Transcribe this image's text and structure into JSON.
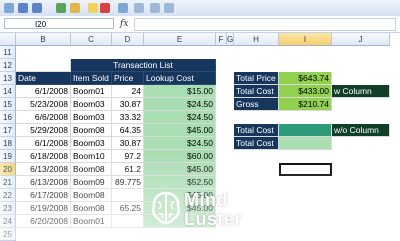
{
  "formula_bar": {
    "name_box": "I20",
    "fx_label": "fx",
    "formula": ""
  },
  "columns": [
    "B",
    "C",
    "D",
    "E",
    "F",
    "G",
    "H",
    "I",
    "J"
  ],
  "rows": [
    "11",
    "12",
    "13",
    "14",
    "15",
    "16",
    "17",
    "18",
    "19",
    "20",
    "21",
    "22",
    "23",
    "24",
    "25"
  ],
  "selected_cell": {
    "column": "I",
    "row": "20"
  },
  "table": {
    "title": "Transaction List",
    "headers": {
      "date": "Date",
      "item": "Item Sold",
      "price": "Price",
      "lookup": "Lookup Cost"
    },
    "rows": [
      {
        "date": "6/1/2008",
        "item": "Boom01",
        "price": "24",
        "lookup": "$15.00"
      },
      {
        "date": "5/23/2008",
        "item": "Boom03",
        "price": "30.87",
        "lookup": "$24.50"
      },
      {
        "date": "6/6/2008",
        "item": "Boom03",
        "price": "33.32",
        "lookup": "$24.50"
      },
      {
        "date": "5/29/2008",
        "item": "Boom08",
        "price": "64.35",
        "lookup": "$45.00"
      },
      {
        "date": "6/1/2008",
        "item": "Boom03",
        "price": "30.87",
        "lookup": "$24.50"
      },
      {
        "date": "6/18/2008",
        "item": "Boom10",
        "price": "97.2",
        "lookup": "$60.00"
      },
      {
        "date": "6/13/2008",
        "item": "Boom08",
        "price": "61.2",
        "lookup": "$45.00"
      },
      {
        "date": "6/13/2008",
        "item": "Boom09",
        "price": "89.775",
        "lookup": "$52.50"
      },
      {
        "date": "6/17/2008",
        "item": "Boom08",
        "price": "",
        "lookup": "$45.00"
      },
      {
        "date": "6/19/2008",
        "item": "Boom08",
        "price": "65.25",
        "lookup": "$45.00"
      },
      {
        "date": "6/20/2008",
        "item": "Boom01",
        "price": "",
        "lookup": ""
      }
    ]
  },
  "summary_top": [
    {
      "label": "Total Price",
      "value": "$643.74"
    },
    {
      "label": "Total Cost",
      "value": "$433.00"
    },
    {
      "label": "Gross",
      "value": "$210.74"
    }
  ],
  "summary_top_note": "w Column",
  "summary_bottom": [
    {
      "label": "Total Cost",
      "value": ""
    },
    {
      "label": "Total Cost",
      "value": ""
    }
  ],
  "summary_bottom_note": "w/o Column",
  "watermark": {
    "line1": "Mind",
    "line2": "Luster"
  },
  "colors": {
    "header_navy": "#17365d",
    "green": "#92d050",
    "light_green": "#a9ddb2",
    "teal": "#2c9b7a",
    "dark_green": "#0f3f26"
  }
}
